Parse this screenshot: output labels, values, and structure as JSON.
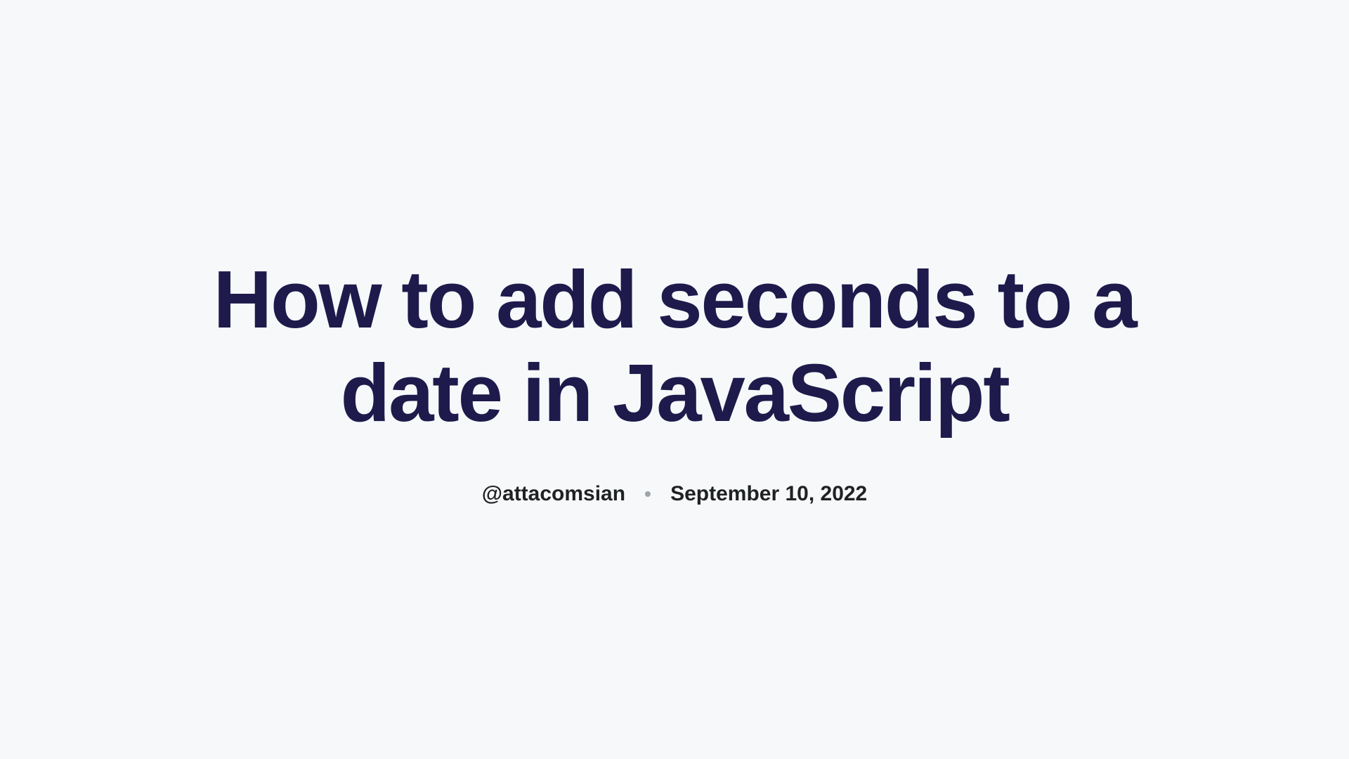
{
  "article": {
    "title": "How to add seconds to a date in JavaScript",
    "author": "@attacomsian",
    "date": "September 10, 2022"
  }
}
